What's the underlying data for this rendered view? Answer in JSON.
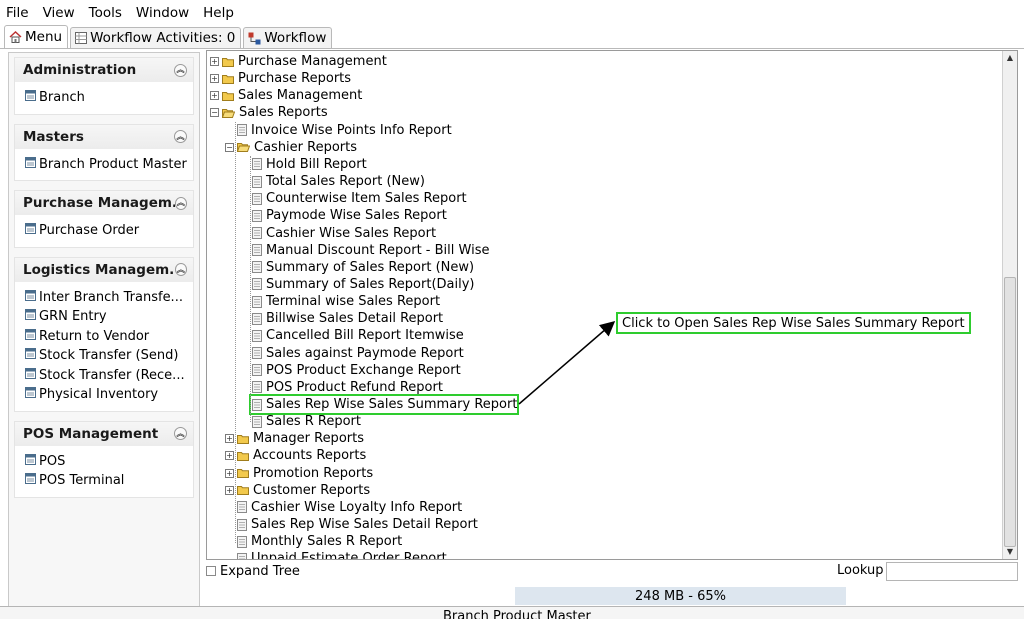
{
  "menubar": {
    "items": [
      {
        "label": "File",
        "mnemonic": "F"
      },
      {
        "label": "View",
        "mnemonic": "V"
      },
      {
        "label": "Tools",
        "mnemonic": "T"
      },
      {
        "label": "Window",
        "mnemonic": ""
      },
      {
        "label": "Help",
        "mnemonic": "H"
      }
    ]
  },
  "tabs": [
    {
      "label": "Menu",
      "icon": "home-icon",
      "active": true
    },
    {
      "label": "Workflow Activities: 0",
      "icon": "table-icon",
      "active": false
    },
    {
      "label": "Workflow",
      "icon": "workflow-icon",
      "active": false
    }
  ],
  "sidebar": {
    "groups": [
      {
        "title": "Administration",
        "items": [
          "Branch"
        ]
      },
      {
        "title": "Masters",
        "items": [
          "Branch Product Master"
        ]
      },
      {
        "title": "Purchase Managem...",
        "items": [
          "Purchase Order"
        ]
      },
      {
        "title": "Logistics Managem...",
        "items": [
          "Inter Branch Transfe...",
          "GRN Entry",
          "Return to Vendor",
          "Stock Transfer (Send)",
          "Stock Transfer (Rece...",
          "Physical Inventory"
        ]
      },
      {
        "title": "POS Management",
        "items": [
          "POS",
          "POS Terminal"
        ]
      }
    ]
  },
  "tree": {
    "rows": [
      {
        "label": "Purchase Management",
        "level": 0,
        "kind": "folder",
        "expanded": false
      },
      {
        "label": "Purchase Reports",
        "level": 0,
        "kind": "folder",
        "expanded": false
      },
      {
        "label": "Sales Management",
        "level": 0,
        "kind": "folder",
        "expanded": false
      },
      {
        "label": "Sales Reports",
        "level": 0,
        "kind": "folder",
        "expanded": true
      },
      {
        "label": "Invoice Wise Points Info Report",
        "level": 1,
        "kind": "doc"
      },
      {
        "label": "Cashier Reports",
        "level": 1,
        "kind": "folder",
        "expanded": true
      },
      {
        "label": "Hold Bill Report",
        "level": 2,
        "kind": "doc"
      },
      {
        "label": "Total Sales Report (New)",
        "level": 2,
        "kind": "doc"
      },
      {
        "label": "Counterwise Item Sales Report",
        "level": 2,
        "kind": "doc"
      },
      {
        "label": "Paymode Wise Sales Report",
        "level": 2,
        "kind": "doc"
      },
      {
        "label": "Cashier Wise Sales Report",
        "level": 2,
        "kind": "doc"
      },
      {
        "label": "Manual Discount Report - Bill Wise",
        "level": 2,
        "kind": "doc"
      },
      {
        "label": "Summary of Sales Report (New)",
        "level": 2,
        "kind": "doc"
      },
      {
        "label": "Summary of Sales Report(Daily)",
        "level": 2,
        "kind": "doc"
      },
      {
        "label": "Terminal wise Sales Report",
        "level": 2,
        "kind": "doc"
      },
      {
        "label": "Billwise Sales Detail Report",
        "level": 2,
        "kind": "doc"
      },
      {
        "label": "Cancelled Bill Report Itemwise",
        "level": 2,
        "kind": "doc"
      },
      {
        "label": "Sales against Paymode Report",
        "level": 2,
        "kind": "doc"
      },
      {
        "label": "POS Product Exchange Report",
        "level": 2,
        "kind": "doc"
      },
      {
        "label": "POS Product Refund Report",
        "level": 2,
        "kind": "doc"
      },
      {
        "label": "Sales Rep Wise Sales Summary Report",
        "level": 2,
        "kind": "doc",
        "highlighted": true
      },
      {
        "label": "Sales R Report",
        "level": 2,
        "kind": "doc"
      },
      {
        "label": "Manager Reports",
        "level": 1,
        "kind": "folder",
        "expanded": false
      },
      {
        "label": "Accounts Reports",
        "level": 1,
        "kind": "folder",
        "expanded": false
      },
      {
        "label": "Promotion Reports",
        "level": 1,
        "kind": "folder",
        "expanded": false
      },
      {
        "label": "Customer Reports",
        "level": 1,
        "kind": "folder",
        "expanded": false
      },
      {
        "label": "Cashier Wise Loyalty Info Report",
        "level": 1,
        "kind": "doc"
      },
      {
        "label": "Sales Rep Wise Sales Detail Report",
        "level": 1,
        "kind": "doc"
      },
      {
        "label": "Monthly Sales R Report",
        "level": 1,
        "kind": "doc"
      },
      {
        "label": "Unpaid Estimate Order Report",
        "level": 1,
        "kind": "doc"
      }
    ]
  },
  "callout": {
    "text": "Click to Open Sales Rep Wise Sales Summary Report"
  },
  "footer": {
    "expand_tree_label": "Expand Tree",
    "expand_tree_checked": false,
    "lookup_label": "Lookup",
    "lookup_value": "",
    "memory_text": "248 MB - 65%",
    "status_text": "Branch Product Master"
  },
  "colors": {
    "highlight": "#2ecc2e",
    "folder": "#f2c94c"
  }
}
